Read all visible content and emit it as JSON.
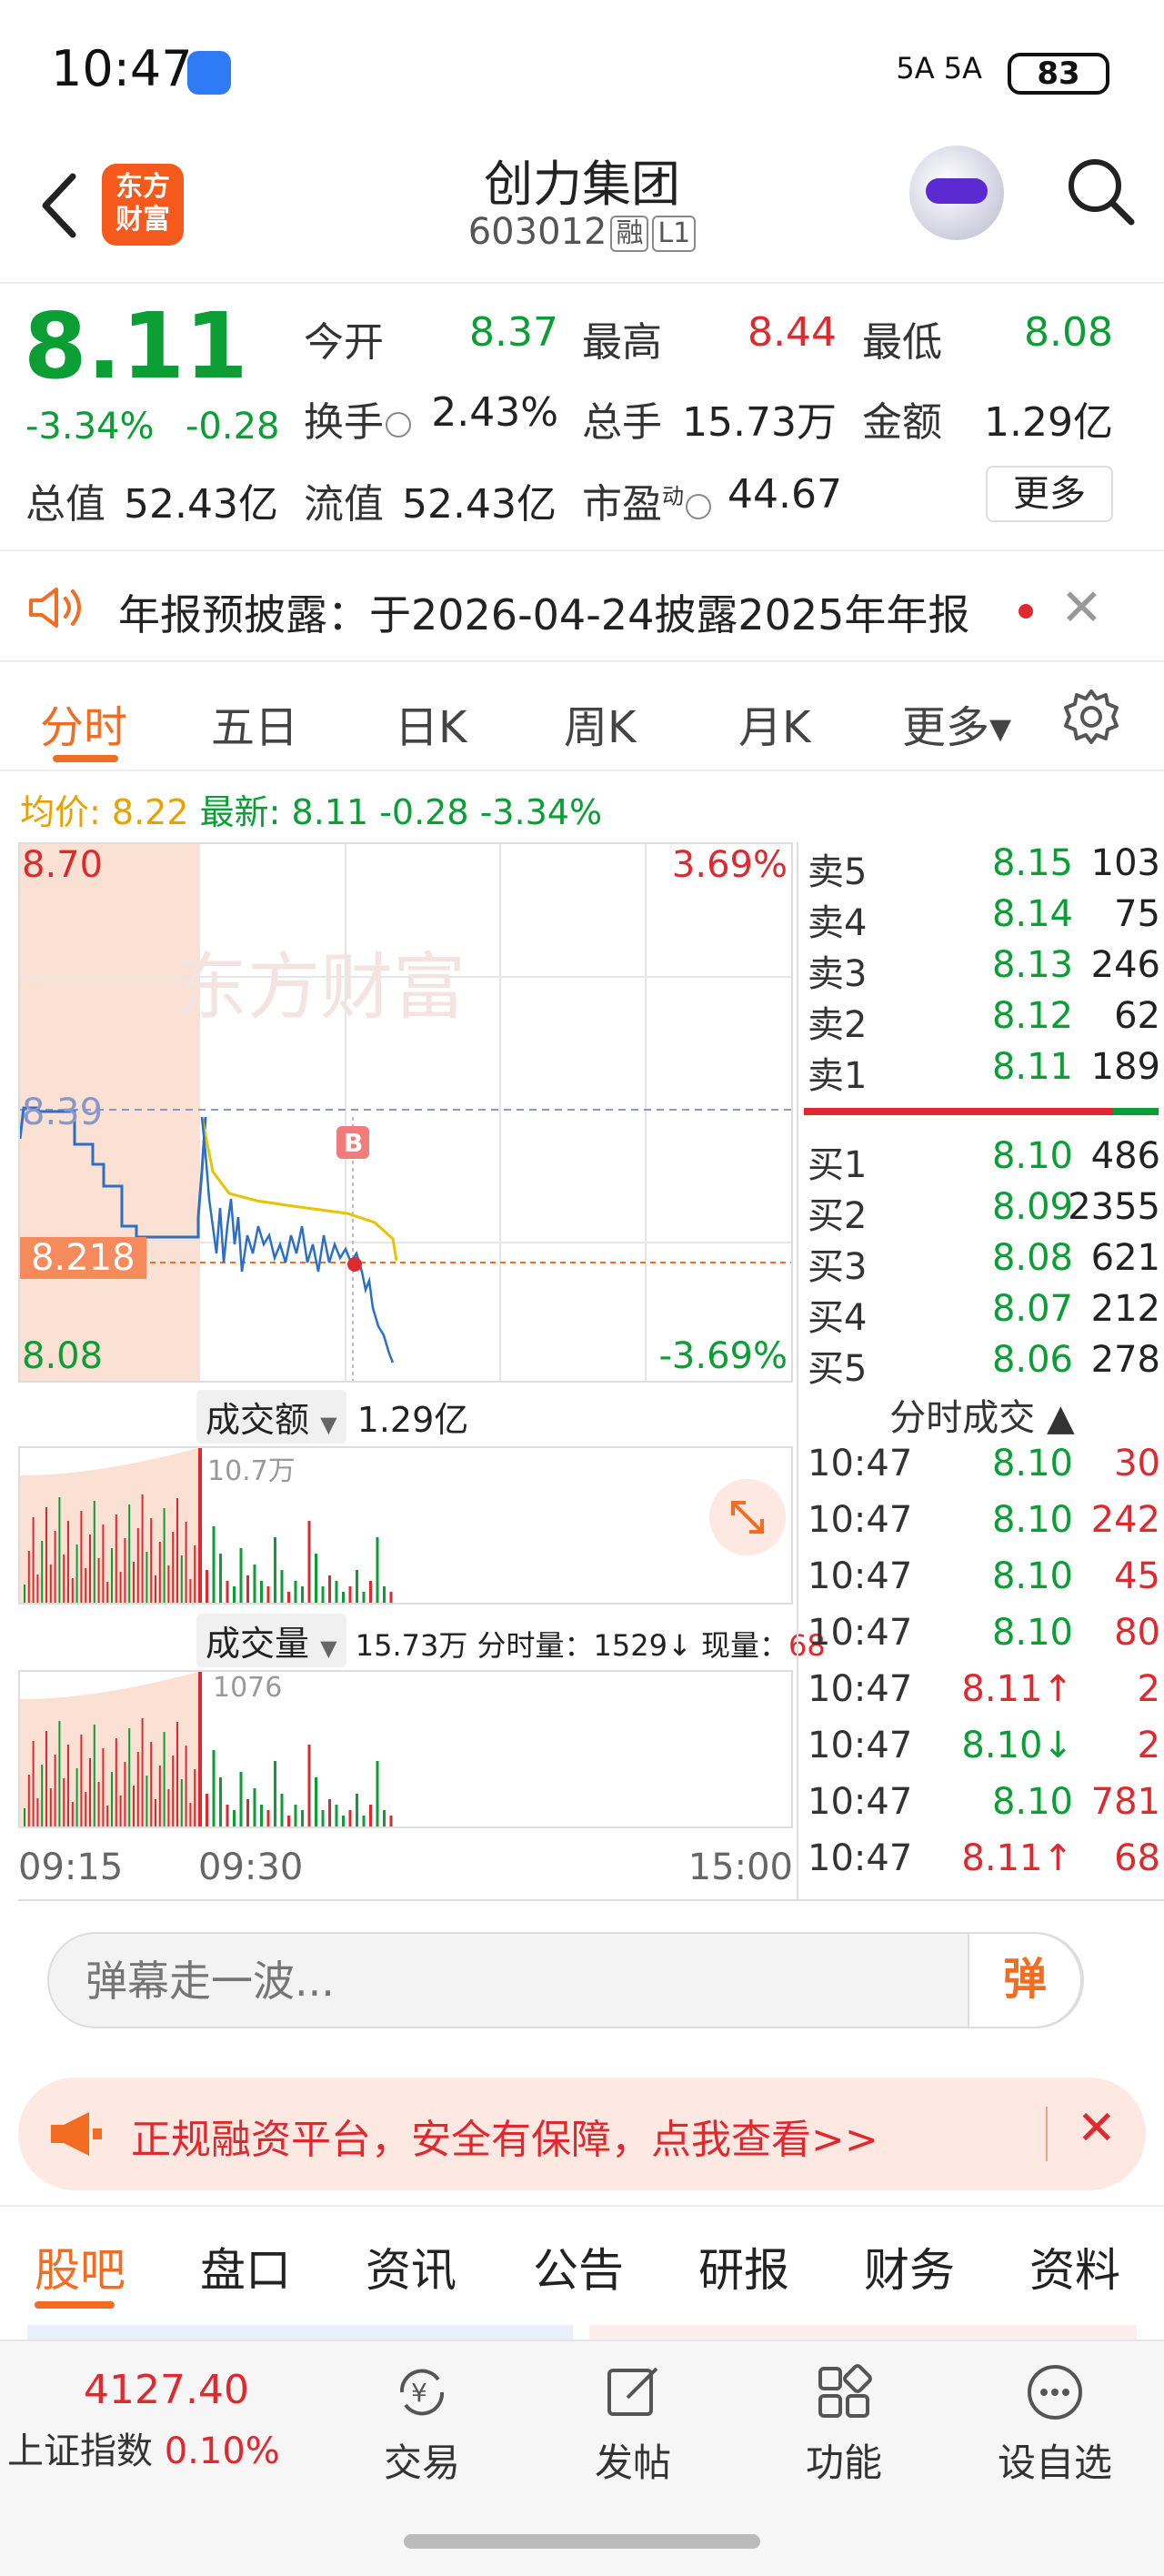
{
  "status_bar": {
    "time": "10:47",
    "signal_text": "5A 5A",
    "battery": "83"
  },
  "header": {
    "logo_text_1": "东方",
    "logo_text_2": "财富",
    "stock_name": "创力集团",
    "stock_code": "603012",
    "tag_margin": "融",
    "tag_level": "L1"
  },
  "quote": {
    "price": "8.11",
    "pct_change": "-3.34%",
    "amt_change": "-0.28",
    "open_label": "今开",
    "open": "8.37",
    "high_label": "最高",
    "high": "8.44",
    "low_label": "最低",
    "low": "8.08",
    "turnover_label": "换手",
    "turnover": "2.43%",
    "volume_label": "总手",
    "volume": "15.73万",
    "amount_label": "金额",
    "amount": "1.29亿",
    "mcap_label": "总值",
    "mcap": "52.43亿",
    "float_label": "流值",
    "float_mcap": "52.43亿",
    "pe_label": "市盈",
    "pe_sup": "动",
    "pe": "44.67",
    "more_button": "更多"
  },
  "notice": {
    "text": "年报预披露：于2026-04-24披露2025年年报"
  },
  "chart_tabs": [
    "分时",
    "五日",
    "日K",
    "周K",
    "月K",
    "更多▾"
  ],
  "avg_line": {
    "avg_label": "均价:",
    "avg": "8.22",
    "latest_label": "最新:",
    "latest": "8.11",
    "change": "-0.28",
    "pct": "-3.34%"
  },
  "chart": {
    "y_top": "8.70",
    "y_ref": "8.39",
    "y_cursor": "8.218",
    "y_bottom": "8.08",
    "pct_top": "3.69%",
    "pct_bottom": "-3.69%",
    "marker": "B",
    "watermark": "东方财富",
    "amount_selector": "成交额",
    "amount_total": "1.29亿",
    "amount_peak": "10.7万",
    "volume_selector": "成交量",
    "volume_summary": "15.73万 分时量：1529↓ 现量：",
    "current_volume": "68",
    "volume_peak": "1076",
    "time_start": "09:15",
    "time_open": "09:30",
    "time_end": "15:00"
  },
  "chart_data": {
    "type": "line",
    "title": "",
    "ylim": [
      8.08,
      8.7
    ],
    "prev_close": 8.39,
    "series": [],
    "x": [
      "09:15",
      "09:30",
      "15:00"
    ]
  },
  "order_book": {
    "asks": [
      {
        "label": "卖5",
        "price": "8.15",
        "vol": "103"
      },
      {
        "label": "卖4",
        "price": "8.14",
        "vol": "75"
      },
      {
        "label": "卖3",
        "price": "8.13",
        "vol": "246"
      },
      {
        "label": "卖2",
        "price": "8.12",
        "vol": "62"
      },
      {
        "label": "卖1",
        "price": "8.11",
        "vol": "189"
      }
    ],
    "bids": [
      {
        "label": "买1",
        "price": "8.10",
        "vol": "486"
      },
      {
        "label": "买2",
        "price": "8.09",
        "vol": "2355"
      },
      {
        "label": "买3",
        "price": "8.08",
        "vol": "621"
      },
      {
        "label": "买4",
        "price": "8.07",
        "vol": "212"
      },
      {
        "label": "买5",
        "price": "8.06",
        "vol": "278"
      }
    ]
  },
  "ticks": {
    "header": "分时成交 ▲",
    "rows": [
      {
        "time": "10:47",
        "price": "8.10",
        "vol": "30"
      },
      {
        "time": "10:47",
        "price": "8.10",
        "vol": "242"
      },
      {
        "time": "10:47",
        "price": "8.10",
        "vol": "45"
      },
      {
        "time": "10:47",
        "price": "8.10",
        "vol": "80"
      },
      {
        "time": "10:47",
        "price": "8.11↑",
        "vol": "2"
      },
      {
        "time": "10:47",
        "price": "8.10↓",
        "vol": "2"
      },
      {
        "time": "10:47",
        "price": "8.10",
        "vol": "781"
      },
      {
        "time": "10:47",
        "price": "8.11↑",
        "vol": "68"
      }
    ]
  },
  "danmu": {
    "placeholder": "弹幕走一波...",
    "button": "弹"
  },
  "ad": {
    "text": "正规融资平台，安全有保障，点我查看>>"
  },
  "sub_tabs": [
    "股吧",
    "盘口",
    "资讯",
    "公告",
    "研报",
    "财务",
    "资料"
  ],
  "bottom_nav": {
    "index_value": "4127.40",
    "index_name": "上证指数",
    "index_pct": "0.10%",
    "items": [
      "交易",
      "发帖",
      "功能",
      "设自选"
    ]
  }
}
